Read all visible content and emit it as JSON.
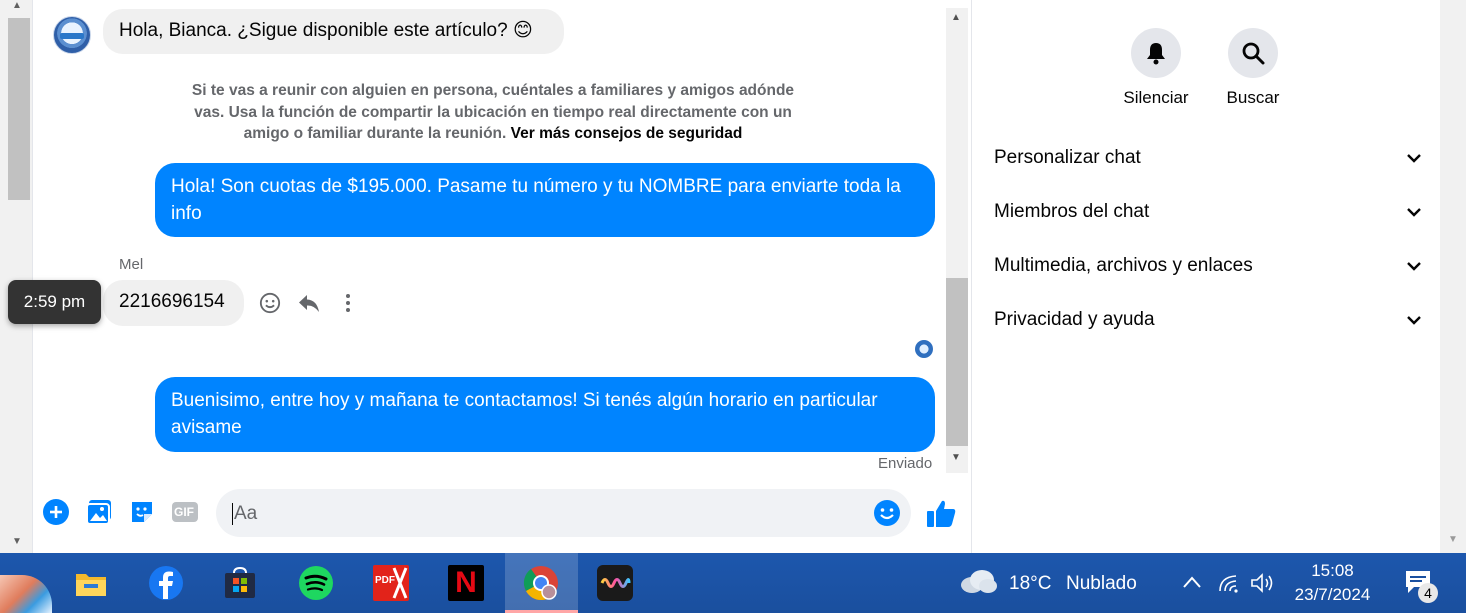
{
  "messages": {
    "first_incoming": {
      "text": "Hola, Bianca. ¿Sigue disponible este artículo? 😊"
    },
    "safety_notice": {
      "text": "Si te vas a reunir con alguien en persona, cuéntales a familiares y amigos adónde vas. Usa la función de compartir la ubicación en tiempo real directamente con un amigo o familiar durante la reunión.",
      "link": "Ver más consejos de seguridad"
    },
    "outgoing_1": {
      "text": "Hola! Son cuotas de $195.000. Pasame tu número y tu NOMBRE  para enviarte toda la info"
    },
    "sender_name": "Mel",
    "incoming_2": {
      "text": "2216696154"
    },
    "hover_time": "2:59 pm",
    "outgoing_2": {
      "text": "Buenisimo, entre hoy y mañana te contactamos! Si tenés algún horario en particular avisame"
    },
    "status": "Enviado"
  },
  "composer": {
    "placeholder": "Aa",
    "gif_label": "GIF",
    "icons": [
      "plus-circle-icon",
      "photo-icon",
      "sticker-icon",
      "gif-icon",
      "emoji-icon",
      "thumbs-up-icon"
    ]
  },
  "panel": {
    "actions": [
      {
        "label": "Silenciar",
        "icon": "bell-icon"
      },
      {
        "label": "Buscar",
        "icon": "search-icon"
      }
    ],
    "sections": [
      {
        "label": "Personalizar chat"
      },
      {
        "label": "Miembros del chat"
      },
      {
        "label": "Multimedia, archivos y enlaces"
      },
      {
        "label": "Privacidad y ayuda"
      }
    ]
  },
  "taskbar": {
    "apps": [
      "file-explorer-icon",
      "facebook-icon",
      "microsoft-store-icon",
      "spotify-icon",
      "pdf-reader-icon",
      "netflix-icon",
      "chrome-icon",
      "sound-app-icon"
    ],
    "pdf_label": "PDF",
    "netflix_label": "N",
    "weather": {
      "temp": "18°C",
      "condition": "Nublado"
    },
    "clock": {
      "time": "15:08",
      "date": "23/7/2024"
    },
    "notifications": "4"
  },
  "colors": {
    "outgoing_bubble": "#0084ff",
    "incoming_bubble": "#f0f0f0",
    "accent": "#0084ff",
    "taskbar": "#1a50a0"
  }
}
